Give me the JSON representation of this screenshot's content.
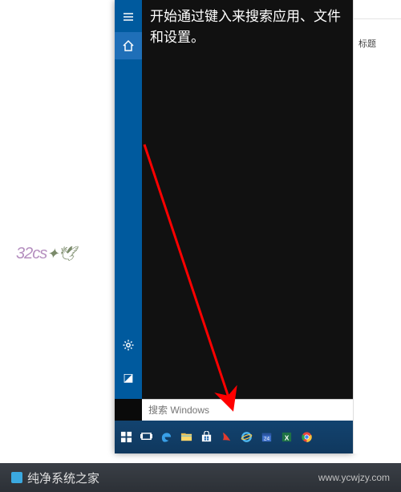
{
  "search_panel": {
    "hint": "开始通过键入来搜索应用、文件和设置。",
    "placeholder": "搜索 Windows"
  },
  "rail": {
    "menu_icon": "menu",
    "home_icon": "home",
    "settings_icon": "settings",
    "feedback_icon": "feedback"
  },
  "taskbar": {
    "items": [
      "start",
      "taskview",
      "edge",
      "explorer",
      "store",
      "clip",
      "ie",
      "calendar",
      "excel",
      "chrome"
    ]
  },
  "right_strip": {
    "label": "标题"
  },
  "footer": {
    "brand": "纯净系统之家",
    "url": "www.ycwjzy.com"
  },
  "watermark": "32cs"
}
